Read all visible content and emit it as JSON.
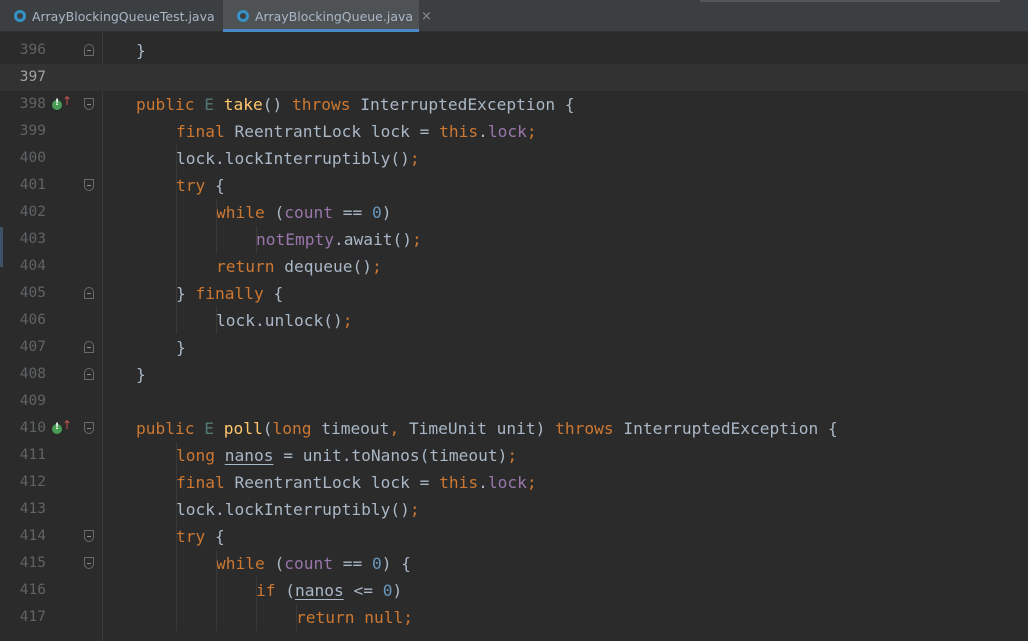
{
  "tabs": [
    {
      "label": "ArrayBlockingQueueTest.java",
      "active": false,
      "icon": "java-class-icon"
    },
    {
      "label": "ArrayBlockingQueue.java",
      "active": true,
      "icon": "java-class-icon"
    }
  ],
  "close_glyph": "×",
  "editor": {
    "current_line": "397",
    "lines": [
      {
        "num": "396",
        "tokens": [
          [
            "p",
            "}"
          ]
        ]
      },
      {
        "num": "397",
        "tokens": []
      },
      {
        "num": "398",
        "tokens": [
          [
            "kw",
            "public "
          ],
          [
            "tp",
            "E "
          ],
          [
            "fn",
            "take"
          ],
          [
            "p",
            "() "
          ],
          [
            "kw",
            "throws "
          ],
          [
            "p",
            "InterruptedException {"
          ]
        ]
      },
      {
        "num": "399",
        "tokens": [
          [
            "kw",
            "final "
          ],
          [
            "p",
            "ReentrantLock lock = "
          ],
          [
            "kw",
            "this"
          ],
          [
            "p",
            "."
          ],
          [
            "fld",
            "lock"
          ],
          [
            "kw",
            ";"
          ]
        ]
      },
      {
        "num": "400",
        "tokens": [
          [
            "p",
            "lock.lockInterruptibly()"
          ],
          [
            "kw",
            ";"
          ]
        ]
      },
      {
        "num": "401",
        "tokens": [
          [
            "kw",
            "try "
          ],
          [
            "p",
            "{"
          ]
        ]
      },
      {
        "num": "402",
        "tokens": [
          [
            "kw",
            "while "
          ],
          [
            "p",
            "("
          ],
          [
            "fld",
            "count"
          ],
          [
            "p",
            " == "
          ],
          [
            "num",
            "0"
          ],
          [
            "p",
            ")"
          ]
        ]
      },
      {
        "num": "403",
        "tokens": [
          [
            "fld",
            "notEmpty"
          ],
          [
            "p",
            ".await()"
          ],
          [
            "kw",
            ";"
          ]
        ]
      },
      {
        "num": "404",
        "tokens": [
          [
            "kw",
            "return "
          ],
          [
            "p",
            "dequeue()"
          ],
          [
            "kw",
            ";"
          ]
        ]
      },
      {
        "num": "405",
        "tokens": [
          [
            "p",
            "} "
          ],
          [
            "kw",
            "finally "
          ],
          [
            "p",
            "{"
          ]
        ]
      },
      {
        "num": "406",
        "tokens": [
          [
            "p",
            "lock.unlock()"
          ],
          [
            "kw",
            ";"
          ]
        ]
      },
      {
        "num": "407",
        "tokens": [
          [
            "p",
            "}"
          ]
        ]
      },
      {
        "num": "408",
        "tokens": [
          [
            "p",
            "}"
          ]
        ]
      },
      {
        "num": "409",
        "tokens": []
      },
      {
        "num": "410",
        "tokens": [
          [
            "kw",
            "public "
          ],
          [
            "tp",
            "E "
          ],
          [
            "fn",
            "poll"
          ],
          [
            "p",
            "("
          ],
          [
            "kw",
            "long "
          ],
          [
            "p",
            "timeout"
          ],
          [
            "kw",
            ", "
          ],
          [
            "p",
            "TimeUnit unit) "
          ],
          [
            "kw",
            "throws "
          ],
          [
            "p",
            "InterruptedException {"
          ]
        ]
      },
      {
        "num": "411",
        "tokens": [
          [
            "kw",
            "long "
          ],
          [
            "ul",
            "nanos"
          ],
          [
            "p",
            " = unit.toNanos(timeout)"
          ],
          [
            "kw",
            ";"
          ]
        ]
      },
      {
        "num": "412",
        "tokens": [
          [
            "kw",
            "final "
          ],
          [
            "p",
            "ReentrantLock lock = "
          ],
          [
            "kw",
            "this"
          ],
          [
            "p",
            "."
          ],
          [
            "fld",
            "lock"
          ],
          [
            "kw",
            ";"
          ]
        ]
      },
      {
        "num": "413",
        "tokens": [
          [
            "p",
            "lock.lockInterruptibly()"
          ],
          [
            "kw",
            ";"
          ]
        ]
      },
      {
        "num": "414",
        "tokens": [
          [
            "kw",
            "try "
          ],
          [
            "p",
            "{"
          ]
        ]
      },
      {
        "num": "415",
        "tokens": [
          [
            "kw",
            "while "
          ],
          [
            "p",
            "("
          ],
          [
            "fld",
            "count"
          ],
          [
            "p",
            " == "
          ],
          [
            "num",
            "0"
          ],
          [
            "p",
            ") {"
          ]
        ]
      },
      {
        "num": "416",
        "tokens": [
          [
            "kw",
            "if "
          ],
          [
            "p",
            "("
          ],
          [
            "ul",
            "nanos"
          ],
          [
            "p",
            " <= "
          ],
          [
            "num",
            "0"
          ],
          [
            "p",
            ")"
          ]
        ]
      },
      {
        "num": "417",
        "tokens": [
          [
            "kw",
            "return null;"
          ]
        ]
      }
    ]
  },
  "colors": {
    "background": "#2b2b2b",
    "keyword": "#cc7832",
    "method": "#ffc66d",
    "field": "#9876aa",
    "number": "#6897bb",
    "text": "#a9b7c6",
    "line_number": "#606366",
    "tab_accent": "#4a88c7"
  },
  "gutter_marks": {
    "398": "implements-method-icon",
    "410": "implements-method-icon"
  }
}
